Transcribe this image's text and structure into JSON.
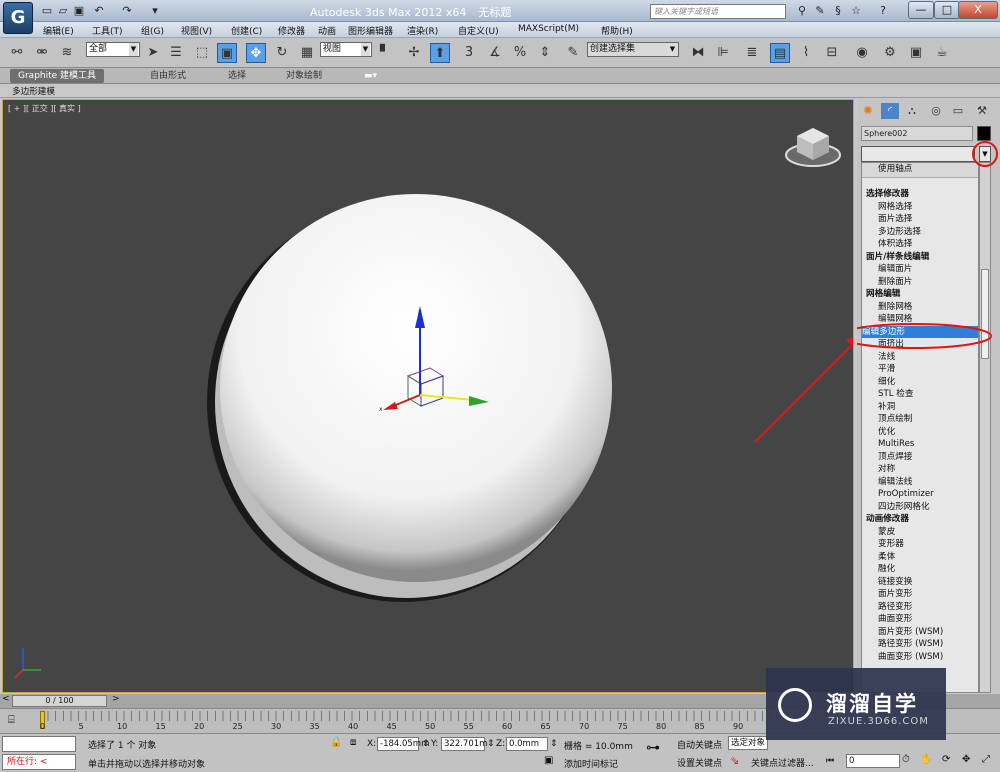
{
  "window": {
    "app_title": "Autodesk 3ds Max  2012 x64",
    "doc_title": "无标题",
    "search_placeholder": "键入关键字或短语",
    "logo_text": "G",
    "min_glyph": "—",
    "max_glyph": "□",
    "close_glyph": "X",
    "help_glyph": "?"
  },
  "menu": [
    "编辑(E)",
    "工具(T)",
    "组(G)",
    "视图(V)",
    "创建(C)",
    "修改器",
    "动画",
    "图形编辑器",
    "渲染(R)",
    "自定义(U)",
    "MAXScript(M)",
    "帮助(H)"
  ],
  "toolbar": {
    "selection_filter": "全部",
    "ref_coord": "视图",
    "named_selection": "创建选择集",
    "snap_3": "3",
    "percent_snap": "%"
  },
  "ribbon": {
    "tabs": [
      "Graphite 建模工具",
      "自由形式",
      "选择",
      "对象绘制"
    ],
    "panel": "多边形建模"
  },
  "viewport": {
    "label": "[ + ][ 正交 ][ 真实 ]",
    "gizmo_x": "x",
    "gizmo_z": "z"
  },
  "command_panel": {
    "object_name": "Sphere002",
    "modifier_list": [
      {
        "text": "使用轴点",
        "kind": "top"
      },
      {
        "text": "选择修改器",
        "kind": "cat"
      },
      {
        "text": "网格选择",
        "kind": "item"
      },
      {
        "text": "面片选择",
        "kind": "item"
      },
      {
        "text": "多边形选择",
        "kind": "item"
      },
      {
        "text": "体积选择",
        "kind": "item"
      },
      {
        "text": "面片/样条线编辑",
        "kind": "cat"
      },
      {
        "text": "编辑面片",
        "kind": "item"
      },
      {
        "text": "删除面片",
        "kind": "item"
      },
      {
        "text": "网格编辑",
        "kind": "cat"
      },
      {
        "text": "删除网格",
        "kind": "item"
      },
      {
        "text": "编辑网格",
        "kind": "item"
      },
      {
        "text": "编辑多边形",
        "kind": "sel"
      },
      {
        "text": "面挤出",
        "kind": "item"
      },
      {
        "text": "法线",
        "kind": "item"
      },
      {
        "text": "平滑",
        "kind": "item"
      },
      {
        "text": "细化",
        "kind": "item"
      },
      {
        "text": "STL 检查",
        "kind": "item"
      },
      {
        "text": "补洞",
        "kind": "item"
      },
      {
        "text": "顶点绘制",
        "kind": "item"
      },
      {
        "text": "优化",
        "kind": "item"
      },
      {
        "text": "MultiRes",
        "kind": "item"
      },
      {
        "text": "顶点焊接",
        "kind": "item"
      },
      {
        "text": "对称",
        "kind": "item"
      },
      {
        "text": "编辑法线",
        "kind": "item"
      },
      {
        "text": "ProOptimizer",
        "kind": "item"
      },
      {
        "text": "四边形网格化",
        "kind": "item"
      },
      {
        "text": "动画修改器",
        "kind": "cat"
      },
      {
        "text": "蒙皮",
        "kind": "item"
      },
      {
        "text": "变形器",
        "kind": "item"
      },
      {
        "text": "柔体",
        "kind": "item"
      },
      {
        "text": "融化",
        "kind": "item"
      },
      {
        "text": "链接变换",
        "kind": "item"
      },
      {
        "text": "面片变形",
        "kind": "item"
      },
      {
        "text": "路径变形",
        "kind": "item"
      },
      {
        "text": "曲面变形",
        "kind": "item"
      },
      {
        "text": "面片变形 (WSM)",
        "kind": "item"
      },
      {
        "text": "路径变形 (WSM)",
        "kind": "item"
      },
      {
        "text": "曲面变形 (WSM)",
        "kind": "item"
      }
    ]
  },
  "timeline": {
    "frame": "0 / 100",
    "ruler_numbers": [
      "0",
      "5",
      "10",
      "15",
      "20",
      "25",
      "30",
      "35",
      "40",
      "45",
      "50",
      "55",
      "60",
      "65",
      "70",
      "75",
      "80",
      "85",
      "90"
    ]
  },
  "status": {
    "maxscript_prompt": "所在行: <",
    "selection_info": "选择了 1 个 对象",
    "hint": "单击并拖动以选择并移动对象",
    "x_label": "X:",
    "x_value": "-184.05mm",
    "y_label": "Y:",
    "y_value": "322.701m",
    "z_label": "Z:",
    "z_value": "0.0mm",
    "grid": "栅格 = 10.0mm",
    "auto_key": "自动关键点",
    "set_key": "设置关键点",
    "selected_dropdown": "选定对象",
    "key_filters": "关键点过滤器...",
    "add_time_tag": "添加时间标记",
    "frame_value": "0"
  },
  "watermark": {
    "brand": "溜溜自学",
    "url": "ZIXUE.3D66.COM"
  },
  "colors": {
    "annotation": "#e01515",
    "selection": "#2f7fd6",
    "viewport_bg": "#454545"
  }
}
